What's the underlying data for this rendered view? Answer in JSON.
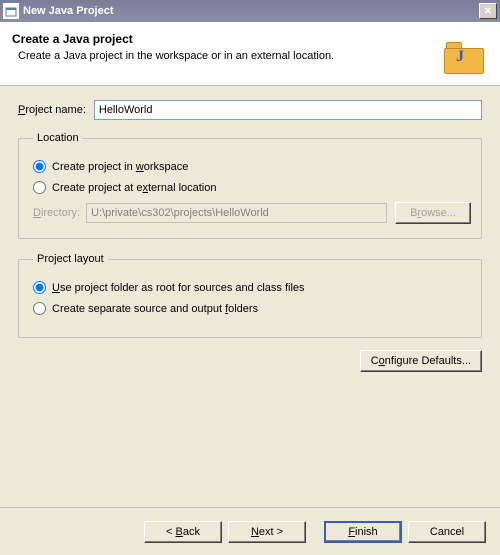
{
  "window": {
    "title": "New Java Project",
    "close": "✕"
  },
  "banner": {
    "heading": "Create a Java project",
    "subtext": "Create a Java project in the workspace or in an external location."
  },
  "project_name": {
    "label_pre": "",
    "label_mn": "P",
    "label_post": "roject name:",
    "value": "HelloWorld"
  },
  "location": {
    "legend": "Location",
    "opt_workspace_pre": "Create project in ",
    "opt_workspace_mn": "w",
    "opt_workspace_post": "orkspace",
    "opt_external_pre": "Create project at e",
    "opt_external_mn": "x",
    "opt_external_post": "ternal location",
    "dir_label_mn": "D",
    "dir_label_post": "irectory:",
    "dir_value": "U:\\private\\cs302\\projects\\HelloWorld",
    "browse_pre": "B",
    "browse_mn": "r",
    "browse_post": "owse...",
    "selected": "workspace"
  },
  "layout": {
    "legend": "Project layout",
    "opt_root_mn": "U",
    "opt_root_post": "se project folder as root for sources and class files",
    "opt_sep_pre": "Create separate source and output ",
    "opt_sep_mn": "f",
    "opt_sep_post": "olders",
    "selected": "root"
  },
  "configure_defaults_pre": "C",
  "configure_defaults_mn": "o",
  "configure_defaults_post": "nfigure Defaults...",
  "footer": {
    "back_pre": "< ",
    "back_mn": "B",
    "back_post": "ack",
    "next_mn": "N",
    "next_post": "ext >",
    "finish_mn": "F",
    "finish_post": "inish",
    "cancel": "Cancel"
  }
}
